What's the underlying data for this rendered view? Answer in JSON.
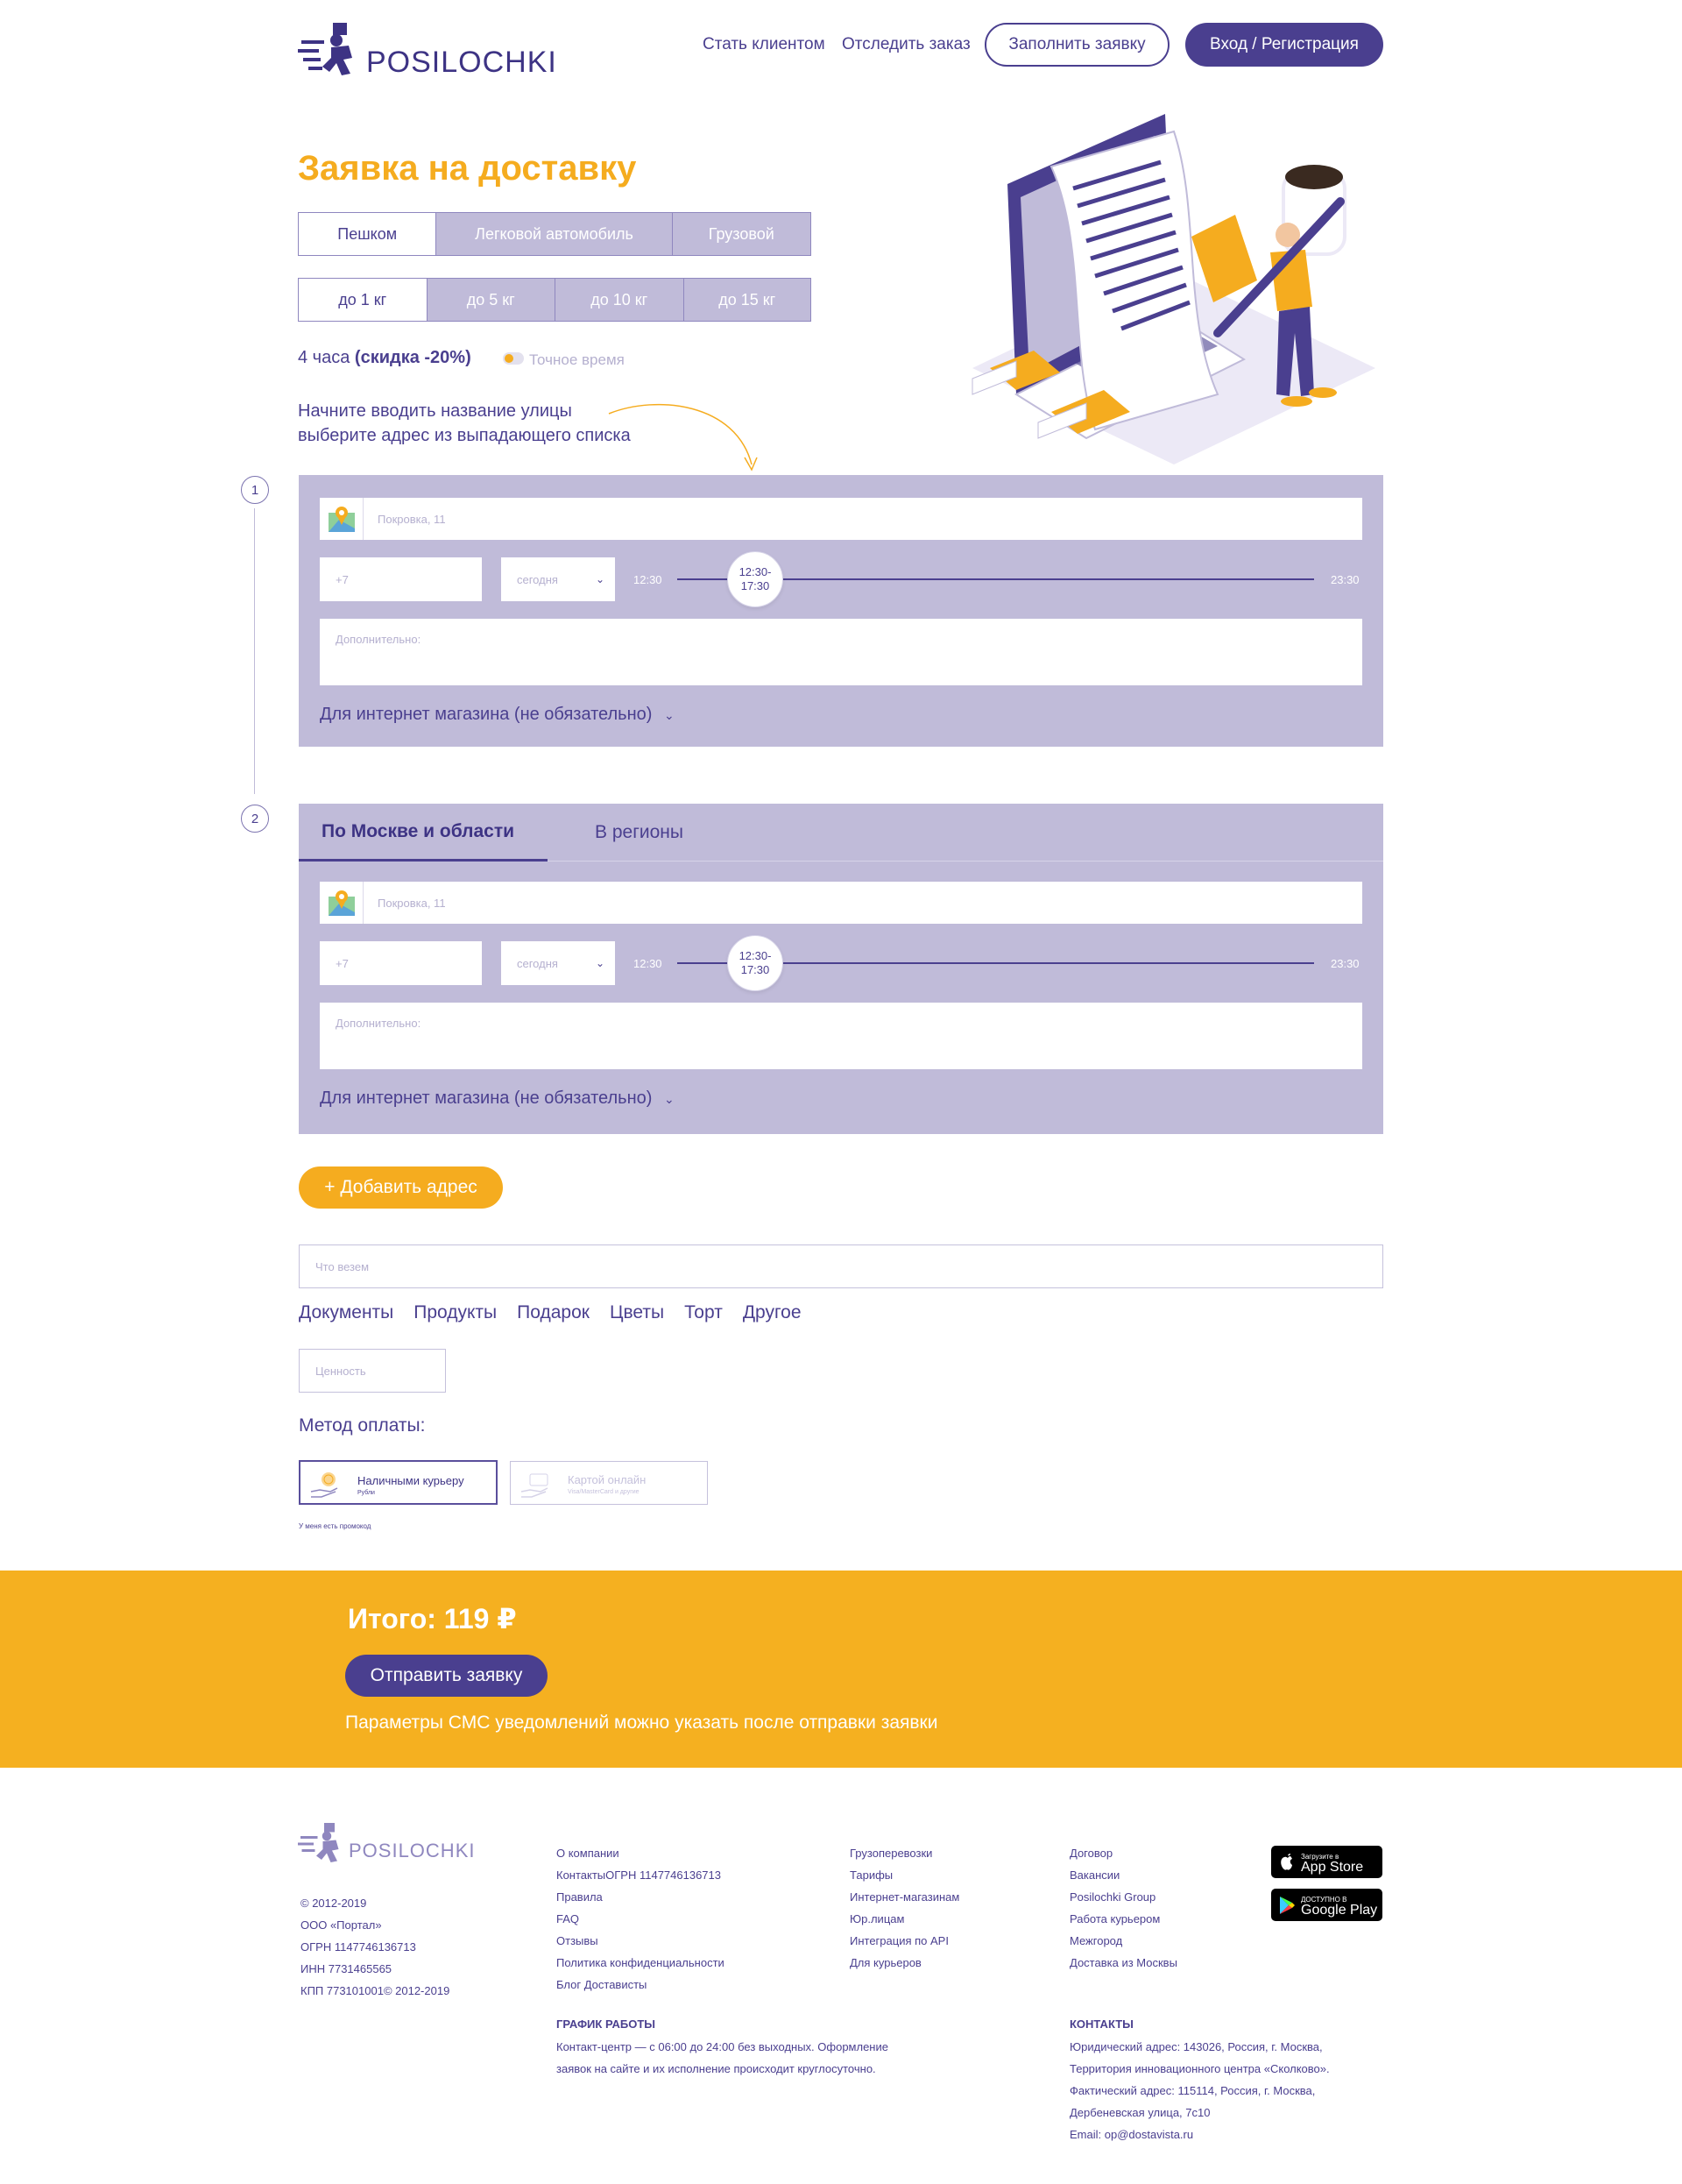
{
  "header": {
    "logo_text": "POSILOCHKI",
    "nav": [
      "Стать клиентом",
      "Отследить заказ"
    ],
    "fill_request_label": "Заполнить заявку",
    "login_label": "Вход / Регистрация"
  },
  "page_title": "Заявка на доставку",
  "transport_tabs": [
    "Пешком",
    "Легковой автомобиль",
    "Грузовой"
  ],
  "weight_tabs": [
    "до 1 кг",
    "до 5 кг",
    "до 10 кг",
    "до 15 кг"
  ],
  "delivery_time": {
    "hours": "4 часа",
    "discount": "(скидка -20%)",
    "exact_time_label": "Точное время"
  },
  "hint": {
    "line1": "Начните вводить название улицы",
    "line2": "выберите адрес из выпадающего списка"
  },
  "address_blocks": [
    {
      "step": "1",
      "address_placeholder": "Покровка, 11",
      "phone_placeholder": "+7",
      "day_select": "сегодня",
      "time_start": "12:30",
      "time_end": "23:30",
      "knob_line1": "12:30-",
      "knob_line2": "17:30",
      "extra_placeholder": "Дополнительно:",
      "shop_label": "Для интернет магазина (не обязательно)"
    },
    {
      "step": "2",
      "tabs": [
        "По Москве и области",
        "В регионы"
      ],
      "address_placeholder": "Покровка, 11",
      "phone_placeholder": "+7",
      "day_select": "сегодня",
      "time_start": "12:30",
      "time_end": "23:30",
      "knob_line1": "12:30-",
      "knob_line2": "17:30",
      "extra_placeholder": "Дополнительно:",
      "shop_label": "Для интернет магазина (не обязательно)"
    }
  ],
  "add_address_label": "+ Добавить адрес",
  "cargo": {
    "placeholder": "Что везем",
    "tags": [
      "Документы",
      "Продукты",
      "Подарок",
      "Цветы",
      "Торт",
      "Другое"
    ],
    "value_placeholder": "Ценность"
  },
  "payment": {
    "title": "Метод оплаты:",
    "options": [
      {
        "label": "Наличными курьеру",
        "sub": "Рубли"
      },
      {
        "label": "Картой онлайн",
        "sub": "Visa/MasterCard и другие"
      }
    ],
    "promo_label": "У меня есть промокод"
  },
  "total": {
    "label": "Итого: 119 ₽",
    "submit_label": "Отправить заявку",
    "sms_note": "Параметры СМС уведомлений можно указать после отправки заявки"
  },
  "footer": {
    "logo_text": "POSILOCHKI",
    "company_lines": [
      "© 2012-2019",
      "ООО «Портал»",
      "ОГРН 1147746136713",
      "ИНН 7731465565",
      "КПП 773101001© 2012-2019"
    ],
    "col1": [
      "О компании",
      "КонтактыОГРН 1147746136713",
      "Правила",
      "FAQ",
      "Отзывы",
      "Политика конфиденциальности",
      "Блог Достависты"
    ],
    "col2": [
      "Грузоперевозки",
      "Тарифы",
      "Интернет-магазинам",
      "Юр.лицам",
      "Интеграция по API",
      "Для курьеров"
    ],
    "col3": [
      "Договор",
      "Вакансии",
      "Posilochki Group",
      "Работа курьером",
      "Межгород",
      "Доставка из Москвы"
    ],
    "schedule_title": "ГРАФИК РАБОТЫ",
    "schedule_lines": [
      "Контакт-центр — с 06:00 до 24:00 без выходных. Оформление",
      "заявок на сайте и их исполнение происходит круглосуточно."
    ],
    "contacts_title": "КОНТАКТЫ",
    "contacts_lines": [
      "Юридический адрес: 143026, Россия, г. Москва,",
      "Территория инновационного центра «Сколково».",
      "Фактический адрес: 115114, Россия, г. Москва,",
      "Дербеневская улица, 7с10",
      "Email: op@dostavista.ru"
    ],
    "appstore_small": "Загрузите в",
    "appstore_big": "App Store",
    "gplay_small": "ДОСТУПНО В",
    "gplay_big": "Google Play"
  },
  "colors": {
    "brand_purple": "#4a3f8f",
    "accent_orange": "#f5ac1f",
    "panel_lilac": "#c0bbd9"
  }
}
